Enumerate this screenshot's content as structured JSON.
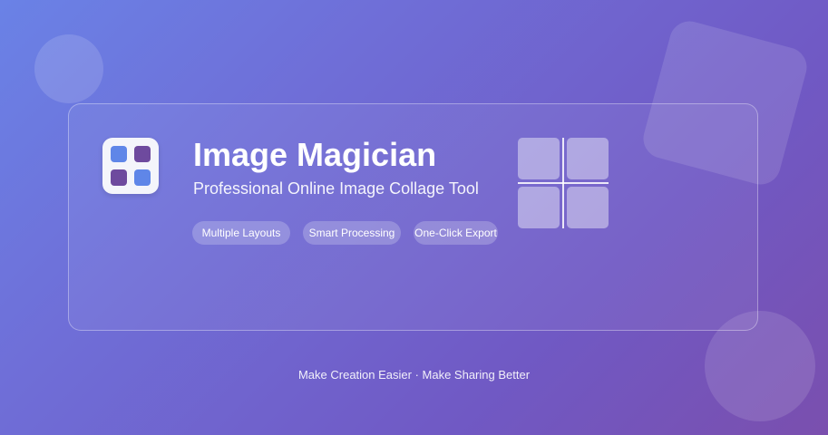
{
  "app": {
    "title": "Image Magician",
    "subtitle": "Professional Online Image Collage Tool",
    "icon": "grid-app-icon"
  },
  "features": [
    {
      "label": "Multiple Layouts"
    },
    {
      "label": "Smart Processing"
    },
    {
      "label": "One-Click Export"
    }
  ],
  "illustration": {
    "icon": "collage-grid-icon"
  },
  "footer": {
    "tagline": "Make Creation Easier · Make Sharing Better"
  },
  "colors": {
    "gradient_start": "#6a82e6",
    "gradient_end": "#7a4fae",
    "icon_blue": "#5f86e8",
    "icon_purple": "#6e4a9e"
  }
}
